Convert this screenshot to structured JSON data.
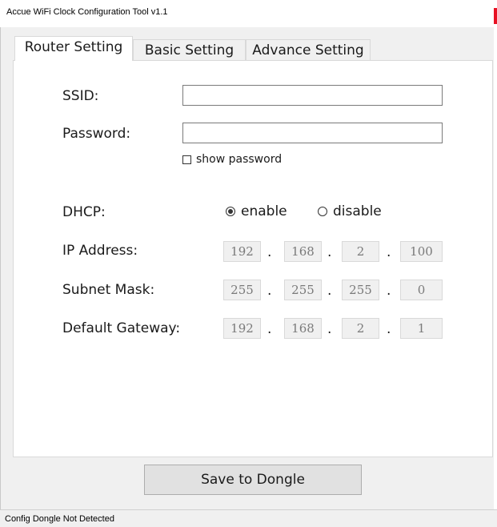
{
  "window": {
    "title": "Accue WiFi Clock Configuration Tool v1.1"
  },
  "tabs": [
    {
      "label": "Router Setting",
      "active": true
    },
    {
      "label": "Basic Setting",
      "active": false
    },
    {
      "label": "Advance Setting",
      "active": false
    }
  ],
  "router": {
    "ssid_label": "SSID:",
    "ssid_value": "",
    "password_label": "Password:",
    "password_value": "",
    "show_password_label": "show password",
    "show_password_checked": false,
    "dhcp_label": "DHCP:",
    "dhcp_enable_label": "enable",
    "dhcp_disable_label": "disable",
    "dhcp_selected": "enable",
    "ip_label": "IP Address:",
    "ip": [
      "192",
      "168",
      "2",
      "100"
    ],
    "subnet_label": "Subnet Mask:",
    "subnet": [
      "255",
      "255",
      "255",
      "0"
    ],
    "gateway_label": "Default Gateway:",
    "gateway": [
      "192",
      "168",
      "2",
      "1"
    ],
    "dot": "."
  },
  "actions": {
    "save_label": "Save to Dongle"
  },
  "status": {
    "text": "Config Dongle Not Detected"
  },
  "colors": {
    "close_button": "#e81123",
    "panel_bg": "#ffffff",
    "window_bg": "#f0f0f0"
  }
}
